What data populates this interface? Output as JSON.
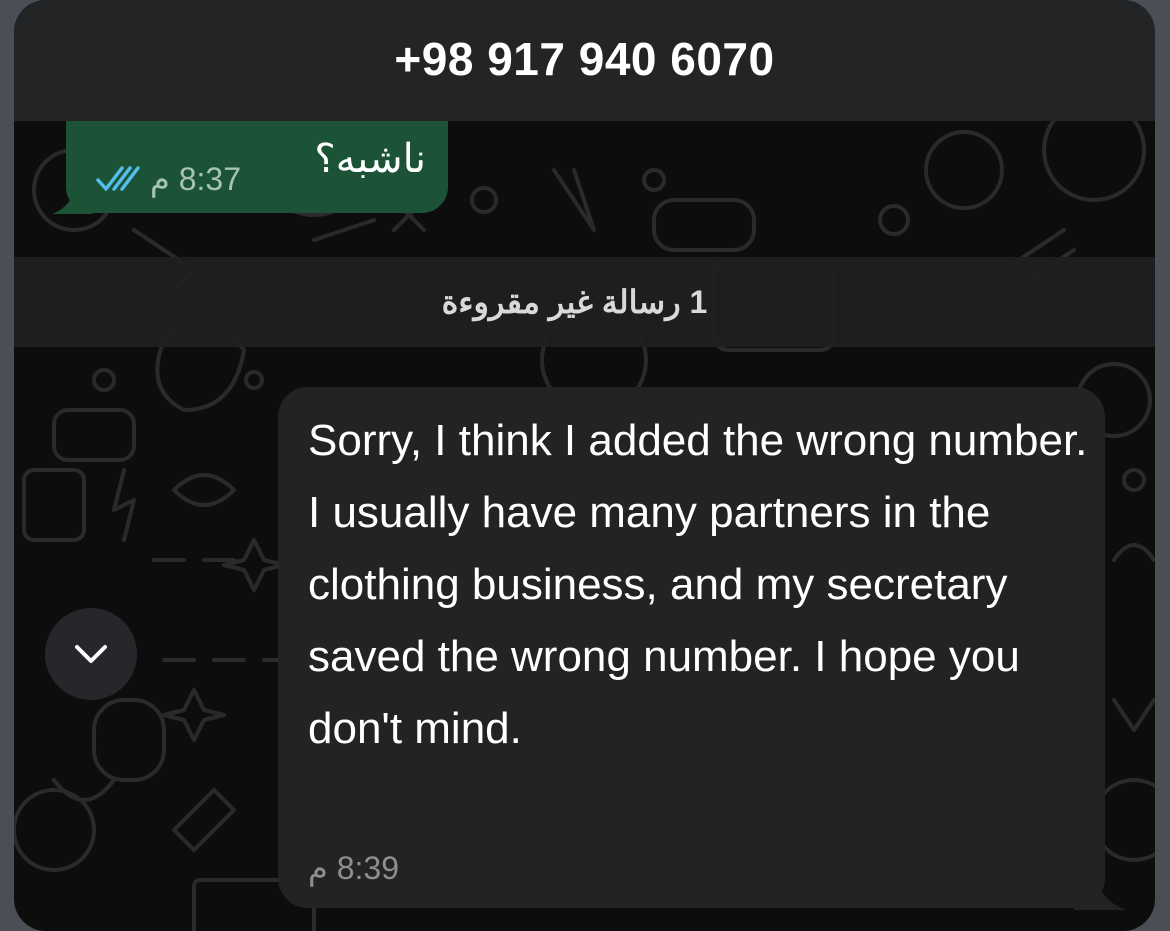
{
  "header": {
    "title": "+98 917 940 6070"
  },
  "messages": {
    "outgoing": {
      "text": "ناشبه؟",
      "time": "8:37 م",
      "status_icon": "double-check-read-icon"
    },
    "unread_banner": "1 رسالة غير مقروءة",
    "incoming": {
      "text": "Sorry, I think I added the wrong number. I usually have many partners in the clothing business, and my secretary saved the wrong number. I hope you don't mind.",
      "time": "8:39 م"
    }
  },
  "scroll_button": {
    "icon": "chevron-down-icon"
  },
  "colors": {
    "header_bg": "#232426",
    "outgoing_bubble": "#1c5336",
    "incoming_bubble": "#222325",
    "read_check": "#53bdeb",
    "background": "#0d0d0d"
  }
}
